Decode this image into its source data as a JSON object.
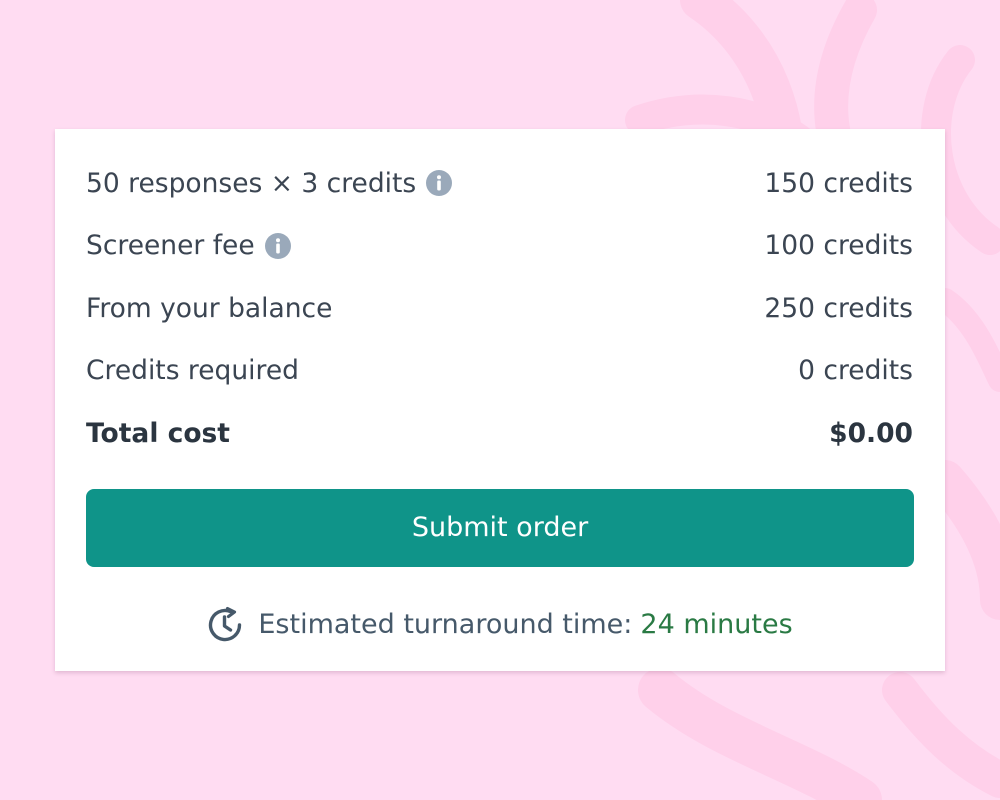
{
  "colors": {
    "background": "#ffdcf2",
    "accent": "#0f9489",
    "highlight": "#2a7a44",
    "info_icon": "#9aa9ba"
  },
  "summary": {
    "rows": [
      {
        "label": "50 responses × 3 credits",
        "value": "150 credits",
        "icon": "info-icon"
      },
      {
        "label": "Screener fee",
        "value": "100 credits",
        "icon": "info-icon"
      },
      {
        "label": "From your balance",
        "value": "250 credits"
      },
      {
        "label": "Credits required",
        "value": "0 credits"
      }
    ],
    "total": {
      "label": "Total cost",
      "value": "$0.00"
    }
  },
  "submit": {
    "label": "Submit order"
  },
  "turnaround": {
    "icon": "clock-icon",
    "label": "Estimated turnaround time:",
    "value": "24 minutes"
  }
}
